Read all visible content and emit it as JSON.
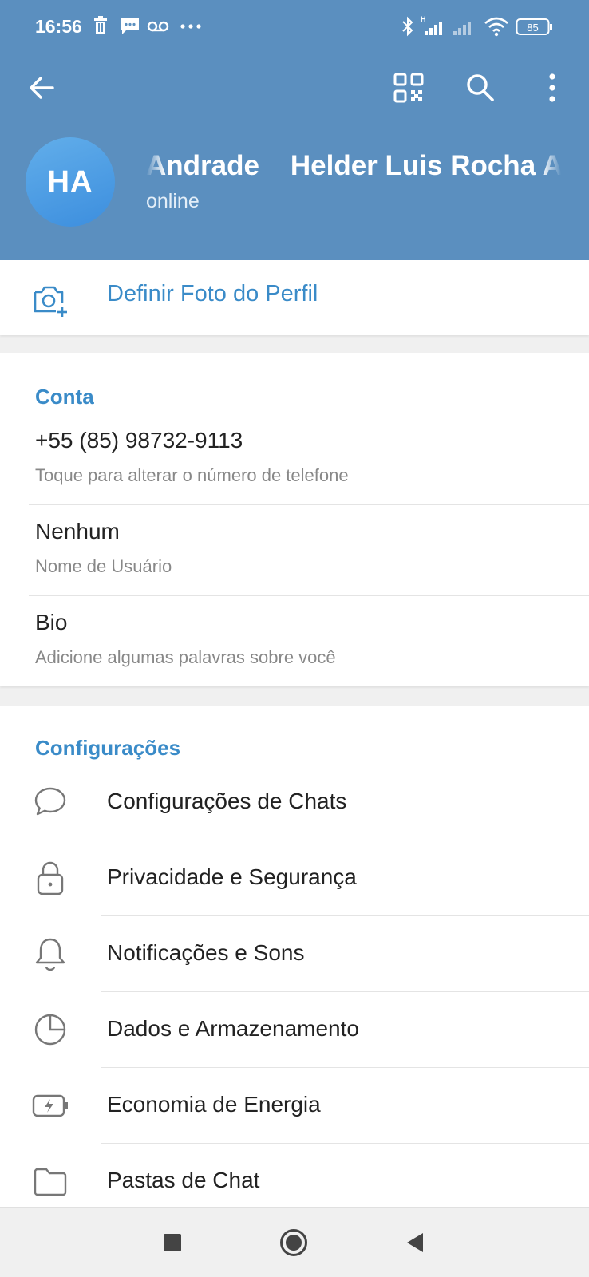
{
  "status_bar": {
    "time": "16:56",
    "battery_level": "85",
    "left_icons": [
      "trash-icon",
      "message-icon",
      "voicemail-icon",
      "more-dots-icon"
    ],
    "right_icons": [
      "bluetooth-icon",
      "signal-h-icon",
      "signal-icon",
      "wifi-icon",
      "battery-icon"
    ]
  },
  "toolbar": {
    "back_icon": "arrow-left-icon",
    "actions": [
      "qr-code-icon",
      "search-icon",
      "more-vert-icon"
    ]
  },
  "profile": {
    "initials": "HA",
    "name_visible": "Andrade    Helder Luis Rocha A",
    "status": "online",
    "avatar_color": "#4a9be3",
    "header_color": "#5b8fbf"
  },
  "set_photo": {
    "label": "Definir Foto do Perfil",
    "icon": "camera-add-icon"
  },
  "account": {
    "title": "Conta",
    "phone": "+55 (85) 98732-9113",
    "phone_hint": "Toque para alterar o número de telefone",
    "username": "Nenhum",
    "username_hint": "Nome de Usuário",
    "bio": "Bio",
    "bio_hint": "Adicione algumas palavras sobre você"
  },
  "settings": {
    "title": "Configurações",
    "items": [
      {
        "label": "Configurações de Chats",
        "icon": "chat-bubble-icon"
      },
      {
        "label": "Privacidade e Segurança",
        "icon": "lock-icon"
      },
      {
        "label": "Notificações e Sons",
        "icon": "bell-icon"
      },
      {
        "label": "Dados e Armazenamento",
        "icon": "pie-chart-icon"
      },
      {
        "label": "Economia de Energia",
        "icon": "battery-bolt-icon"
      },
      {
        "label": "Pastas de Chat",
        "icon": "folder-icon"
      }
    ]
  },
  "nav_bar": {
    "buttons": [
      "recents-square-icon",
      "home-circle-icon",
      "back-triangle-icon"
    ]
  },
  "accent_color": "#3a8bc8"
}
